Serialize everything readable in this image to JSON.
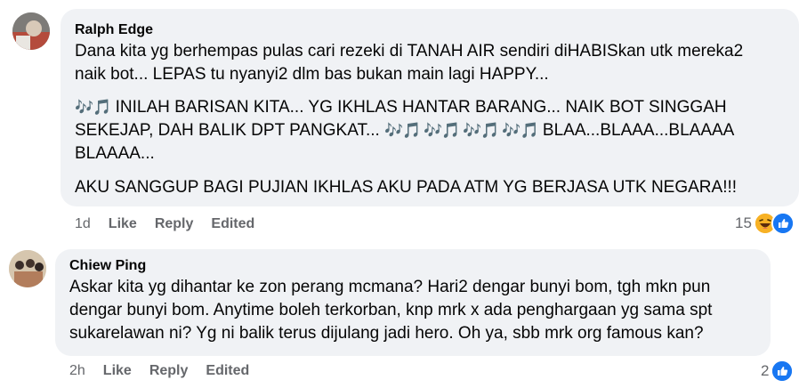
{
  "comments": [
    {
      "author": "Ralph Edge",
      "paragraphs": [
        "Dana kita yg berhempas pulas cari rezeki di TANAH AIR sendiri diHABISkan utk mereka2",
        "naik bot... LEPAS tu nyanyi2 dlm bas bukan main lagi HAPPY...",
        "INILAH BARISAN KITA... YG IKHLAS HANTAR BARANG... NAIK BOT SINGGAH",
        "SEKEJAP, DAH BALIK DPT PANGKAT...",
        "BLAA...BLAAA...BLAAAA",
        "BLAAAA...",
        "AKU SANGGUP BAGI PUJIAN IKHLAS AKU PADA ATM YG BERJASA UTK NEGARA!!!"
      ],
      "music_notes": "🎶🎵",
      "music_notes_row": "🎶🎵 🎶🎵 🎶🎵 🎶🎵",
      "time": "1d",
      "like_label": "Like",
      "reply_label": "Reply",
      "edited_label": "Edited",
      "reaction_count": "15",
      "reactions": [
        "haha-emoji-icon",
        "like-thumb-icon"
      ]
    },
    {
      "author": "Chiew Ping",
      "paragraphs": [
        "Askar kita yg dihantar ke zon perang mcmana? Hari2 dengar bunyi bom, tgh mkn pun",
        "dengar bunyi bom. Anytime boleh terkorban, knp mrk x ada penghargaan yg sama spt",
        "sukarelawan ni? Yg ni balik terus dijulang jadi hero. Oh ya, sbb mrk org famous kan?"
      ],
      "time": "2h",
      "like_label": "Like",
      "reply_label": "Reply",
      "edited_label": "Edited",
      "reaction_count": "2",
      "reactions": [
        "like-thumb-icon"
      ]
    }
  ],
  "colors": {
    "bubble": "#f0f2f5",
    "meta_text": "#65676b",
    "like_blue": "#1877f2",
    "haha_yellow": "#f7b125"
  }
}
